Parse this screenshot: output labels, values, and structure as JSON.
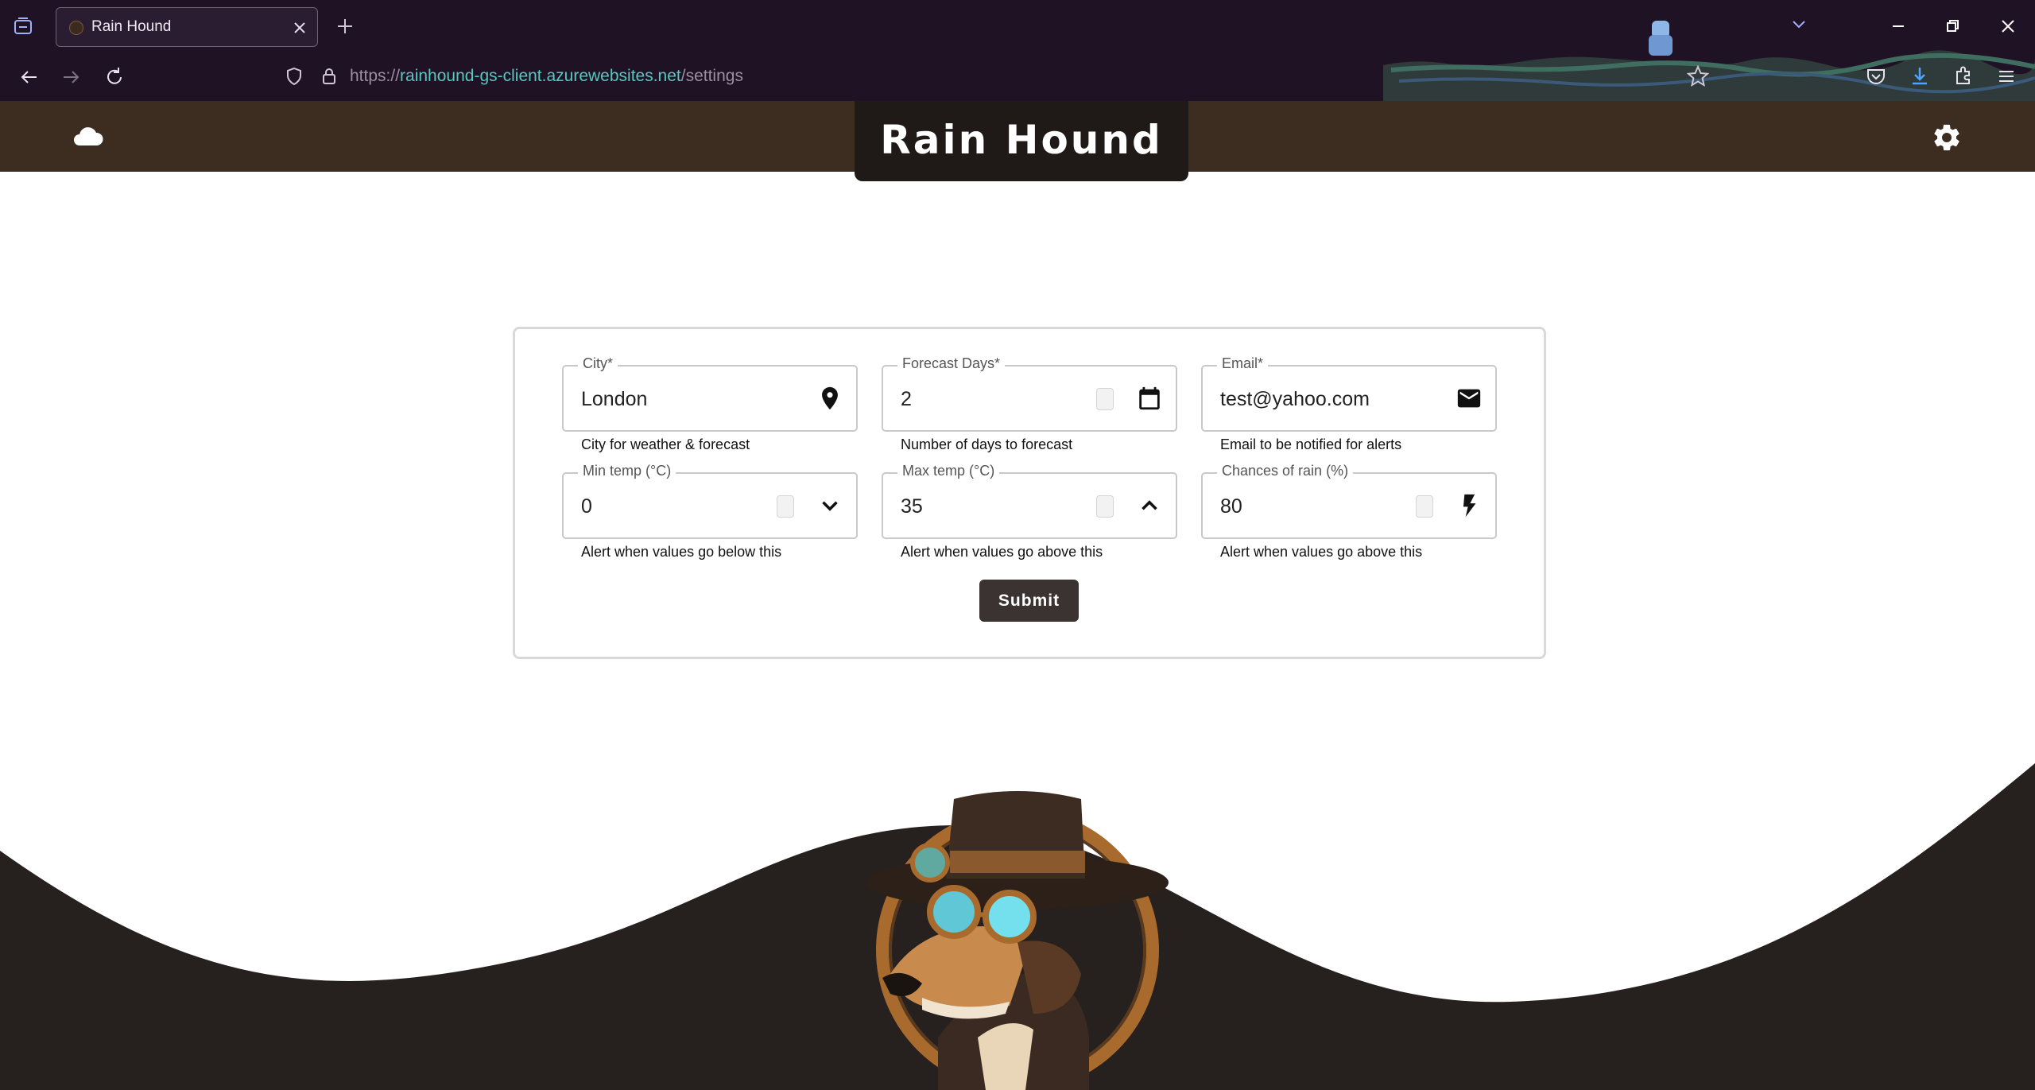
{
  "browser": {
    "tab_title": "Rain Hound",
    "url_prefix": "https://",
    "url_host": "rainhound-gs-client.azurewebsites.net",
    "url_path": "/settings"
  },
  "app": {
    "brand": "Rain Hound"
  },
  "form": {
    "city": {
      "label": "City*",
      "value": "London",
      "helper": "City for weather & forecast",
      "icon": "location-pin-icon"
    },
    "forecast_days": {
      "label": "Forecast Days*",
      "value": "2",
      "helper": "Number of days to forecast",
      "icon": "calendar-icon"
    },
    "email": {
      "label": "Email*",
      "value": "test@yahoo.com",
      "helper": "Email to be notified for alerts",
      "icon": "mail-icon"
    },
    "min_temp": {
      "label": "Min temp (°C)",
      "value": "0",
      "helper": "Alert when values go below this",
      "icon": "chevron-down-icon"
    },
    "max_temp": {
      "label": "Max temp (°C)",
      "value": "35",
      "helper": "Alert when values go above this",
      "icon": "chevron-up-icon"
    },
    "rain": {
      "label": "Chances of rain (%)",
      "value": "80",
      "helper": "Alert when values go above this",
      "icon": "lightning-icon"
    },
    "submit_label": "Submit"
  },
  "colors": {
    "chrome_bg": "#1f1225",
    "header_bg": "#3d2d20",
    "brand_bg": "#1f1a17",
    "wave": "#26211e",
    "button": "#3b3332"
  }
}
